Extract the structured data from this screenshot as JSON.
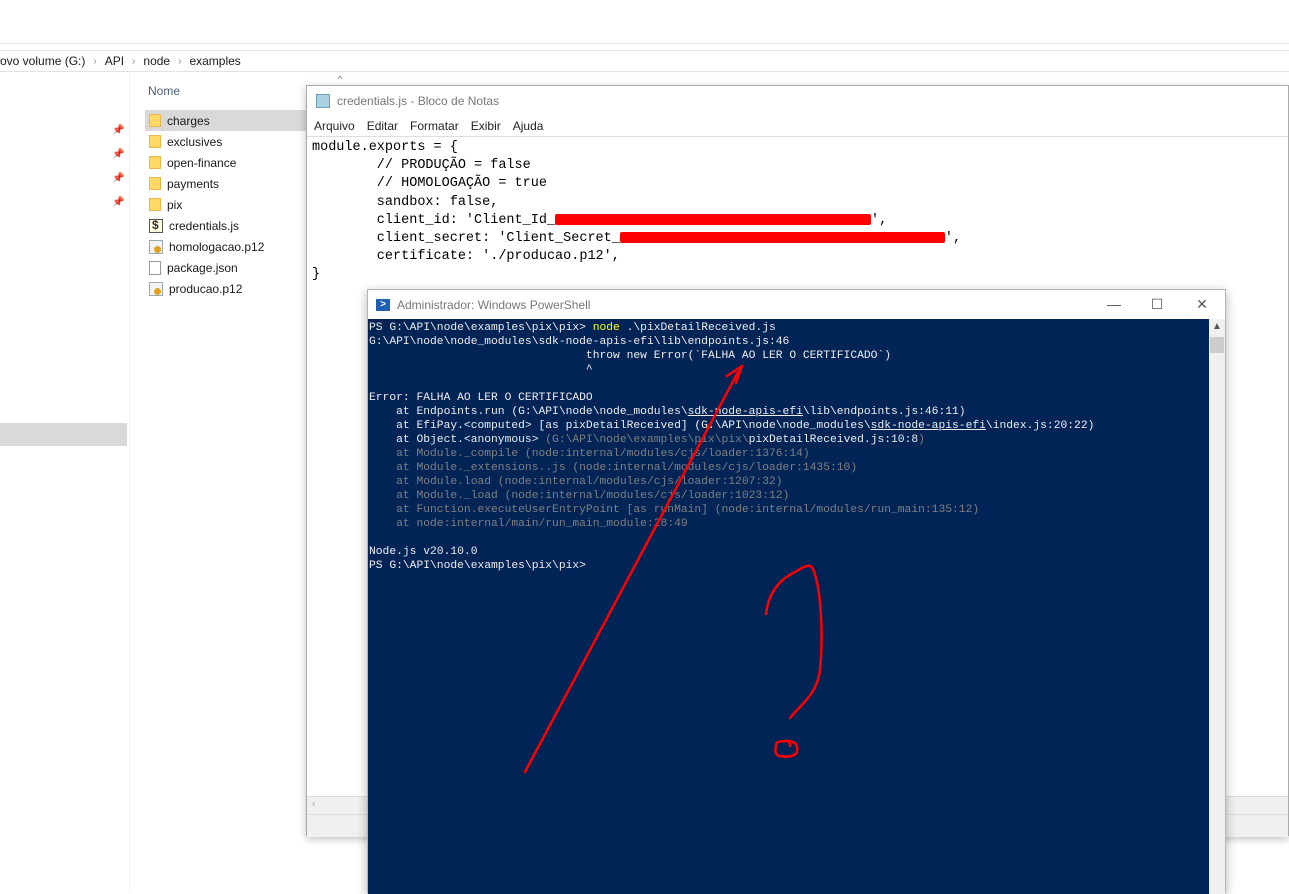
{
  "explorer": {
    "breadcrumb": [
      "ovo volume (G:)",
      "API",
      "node",
      "examples"
    ],
    "column_header": "Nome",
    "files": [
      {
        "name": "charges",
        "type": "folder",
        "icon": "folder-icon",
        "selected": true
      },
      {
        "name": "exclusives",
        "type": "folder",
        "icon": "folder-icon"
      },
      {
        "name": "open-finance",
        "type": "folder",
        "icon": "folder-icon"
      },
      {
        "name": "payments",
        "type": "folder",
        "icon": "folder-icon"
      },
      {
        "name": "pix",
        "type": "folder",
        "icon": "folder-icon"
      },
      {
        "name": "credentials.js",
        "type": "js",
        "icon": "js-file-icon"
      },
      {
        "name": "homologacao.p12",
        "type": "cert",
        "icon": "certificate-icon"
      },
      {
        "name": "package.json",
        "type": "doc",
        "icon": "document-icon"
      },
      {
        "name": "producao.p12",
        "type": "cert",
        "icon": "certificate-icon"
      }
    ]
  },
  "notepad": {
    "title": "credentials.js - Bloco de Notas",
    "menu": [
      "Arquivo",
      "Editar",
      "Formatar",
      "Exibir",
      "Ajuda"
    ],
    "lines": {
      "l1": "module.exports = {",
      "l2": "        // PRODUÇÃO = false",
      "l3": "        // HOMOLOGAÇÃO = true",
      "l4": "        sandbox: false,",
      "l5a": "        client_id: 'Client_Id_",
      "l5b": "',",
      "l6a": "        client_secret: 'Client_Secret_",
      "l6b": "',",
      "l7": "        certificate: './producao.p12',",
      "l8": "}"
    }
  },
  "powershell": {
    "title": "Administrador: Windows PowerShell",
    "controls": {
      "minimize": "—",
      "maximize": "☐",
      "close": "✕"
    },
    "lines": {
      "prompt1": "PS G:\\API\\node\\examples\\pix\\pix> ",
      "cmd": "node",
      "cmd_args": " .\\pixDetailReceived.js",
      "l2": "G:\\API\\node\\node_modules\\sdk-node-apis-efi\\lib\\endpoints.js:46",
      "l3": "                                throw new Error(`FALHA AO LER O CERTIFICADO`)",
      "l4": "                                ^",
      "l6": "Error: FALHA AO LER O CERTIFICADO",
      "l7a": "    at Endpoints.run (G:\\API\\node\\node_modules\\",
      "l7b": "sdk-node-apis-efi",
      "l7c": "\\lib\\endpoints.js:46:11)",
      "l8a": "    at EfiPay.<computed> [as pixDetailReceived] (G:\\API\\node\\node_modules\\",
      "l8b": "sdk-node-apis-efi",
      "l8c": "\\index.js:20:22)",
      "l9a": "    at Object.<anonymous> ",
      "l9b": "(G:\\API\\node\\examples\\pix\\pix\\",
      "l9c": "pixDetailReceived.js:10:8",
      "l9d": ")",
      "l10": "    at Module._compile (node:internal/modules/cjs/loader:1376:14)",
      "l11": "    at Module._extensions..js (node:internal/modules/cjs/loader:1435:10)",
      "l12": "    at Module.load (node:internal/modules/cjs/loader:1207:32)",
      "l13": "    at Module._load (node:internal/modules/cjs/loader:1023:12)",
      "l14": "    at Function.executeUserEntryPoint [as runMain] (node:internal/modules/run_main:135:12)",
      "l15": "    at node:internal/main/run_main_module:28:49",
      "l17": "Node.js v20.10.0",
      "l18": "PS G:\\API\\node\\examples\\pix\\pix>"
    }
  },
  "annotations": {
    "color": "#ff0000",
    "items": [
      "arrow",
      "question-mark"
    ]
  }
}
